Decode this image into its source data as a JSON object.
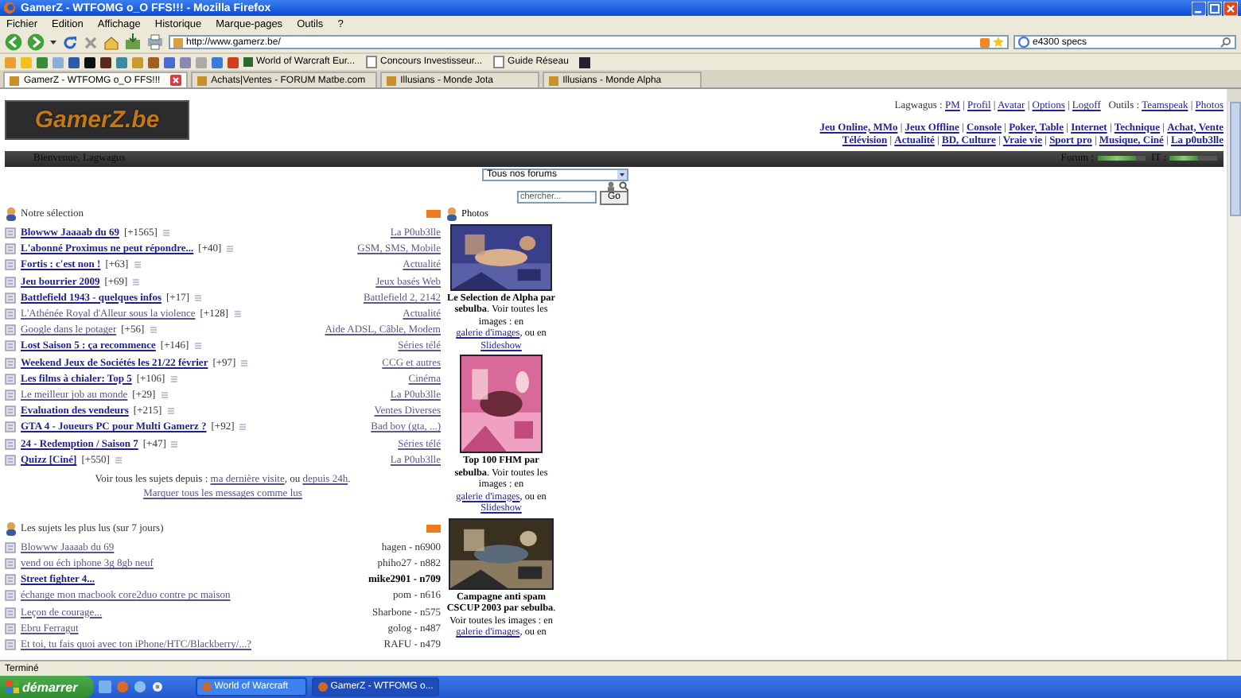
{
  "window": {
    "title": "GamerZ - WTFOMG o_O FFS!!! - Mozilla Firefox"
  },
  "menu": [
    "Fichier",
    "Edition",
    "Affichage",
    "Historique",
    "Marque-pages",
    "Outils",
    "?"
  ],
  "address": {
    "value": "http://www.gamerz.be/"
  },
  "search": {
    "value": "e4300 specs"
  },
  "bookmarks": [
    "World of Warcraft Eur...",
    "Concours Investisseur...",
    "Guide Réseau"
  ],
  "tabs": [
    {
      "label": "GamerZ - WTFOMG o_O FFS!!!",
      "selected": true
    },
    {
      "label": "Achats|Ventes - FORUM Matbe.com",
      "selected": false
    },
    {
      "label": "Illusians - Monde Jota",
      "selected": false
    },
    {
      "label": "Illusians - Monde Alpha",
      "selected": false
    }
  ],
  "site": {
    "logo": "GamerZ.be",
    "separator": "|",
    "user_label": "Lagwagus :",
    "user_links": [
      "PM",
      "Profil",
      "Avatar",
      "Options",
      "Logoff"
    ],
    "tools_label": "Outils :",
    "tools_links": [
      "Teamspeak",
      "Photos"
    ],
    "categories": [
      [
        "Jeu Online, MMo",
        "Jeux Offline",
        "Console",
        "Poker, Table",
        "Internet",
        "Technique",
        "Achat, Vente"
      ],
      [
        "Télévision",
        "Actualité",
        "BD, Culture",
        "Vraie vie",
        "Sport pro",
        "Musique, Ciné",
        "La p0ub3lle"
      ]
    ],
    "welcome": "Bienvenue, Lagwagus",
    "meters": [
      {
        "label": "Forum :",
        "level": 0.8
      },
      {
        "label": "IT :",
        "level": 0.6
      }
    ]
  },
  "forum_select": {
    "value": "Tous nos forums"
  },
  "forum_search": {
    "placeholder": "chercher...",
    "button": "Go"
  },
  "selection": {
    "title": "Notre sélection",
    "topics": [
      {
        "title": "Blowww Jaaaab du 69",
        "count": "[+1565]",
        "unread": true,
        "category": "La P0ub3lle"
      },
      {
        "title": "L'abonné Proximus ne peut répondre...",
        "count": "[+40]",
        "unread": true,
        "category": "GSM, SMS, Mobile"
      },
      {
        "title": "Fortis : c'est non !",
        "count": "[+63]",
        "unread": true,
        "category": "Actualité"
      },
      {
        "title": "Jeu bourrier 2009",
        "count": "[+69]",
        "unread": true,
        "category": "Jeux basés Web"
      },
      {
        "title": "Battlefield 1943 - quelques infos",
        "count": "[+17]",
        "unread": true,
        "category": "Battlefield 2, 2142"
      },
      {
        "title": "L'Athénée Royal d'Alleur sous la violence",
        "count": "[+128]",
        "unread": false,
        "category": "Actualité"
      },
      {
        "title": "Google dans le potager",
        "count": "[+56]",
        "unread": false,
        "category": "Aide ADSL, Câble, Modem"
      },
      {
        "title": "Lost Saison 5 : ça recommence",
        "count": "[+146]",
        "unread": true,
        "category": "Séries télé"
      },
      {
        "title": "Weekend Jeux de Sociétés les 21/22 février",
        "count": "[+97]",
        "unread": true,
        "category": "CCG et autres"
      },
      {
        "title": "Les films à chialer: Top 5",
        "count": "[+106]",
        "unread": true,
        "category": "Cinéma"
      },
      {
        "title": "Le meilleur job au monde",
        "count": "[+29]",
        "unread": false,
        "category": "La P0ub3lle"
      },
      {
        "title": "Evaluation des vendeurs",
        "count": "[+215]",
        "unread": true,
        "category": "Ventes Diverses"
      },
      {
        "title": "GTA 4 - Joueurs PC pour Multi Gamerz ?",
        "count": "[+92]",
        "unread": true,
        "category": "Bad boy (gta, ...)"
      },
      {
        "title": "24 - Redemption / Saison 7",
        "count": "[+47]",
        "unread": true,
        "category": "Séries télé"
      },
      {
        "title": "Quizz [Ciné]",
        "count": "[+550]",
        "unread": true,
        "category": "La P0ub3lle"
      }
    ],
    "footer": {
      "text": "Voir tous les sujets depuis :",
      "link1": "ma dernière visite",
      "middle": ", ou",
      "link2": "depuis 24h",
      "end": ".",
      "mark_all": "Marquer tous les messages comme lus"
    }
  },
  "most_read": {
    "title": "Les sujets les plus lus (sur 7 jours)",
    "topics": [
      {
        "title": "Blowww Jaaaab du 69",
        "author": "hagen - n6900",
        "unread": false
      },
      {
        "title": "vend ou éch iphone 3g 8gb neuf",
        "author": "phiho27 - n882",
        "unread": false
      },
      {
        "title": "Street fighter 4...",
        "author": "mike2901 - n709",
        "unread": true
      },
      {
        "title": "échange mon macbook core2duo contre pc maison",
        "author": "pom - n616",
        "unread": false
      },
      {
        "title": "Leçon de courage...",
        "author": "Sharbone - n575",
        "unread": false
      },
      {
        "title": "Ebru Ferragut",
        "author": "golog - n487",
        "unread": false
      },
      {
        "title": "Et toi, tu fais quoi avec ton iPhone/HTC/Blackberry/...?",
        "author": "RAFU - n479",
        "unread": false
      }
    ]
  },
  "photos": {
    "title": "Photos",
    "items": [
      {
        "kind": "picture",
        "title": "Le Selection de Alpha par sebulba",
        "text": ". Voir toutes les images : en",
        "gallery": "galerie d'images",
        "middle": ", ou en",
        "slideshow": "Slideshow"
      },
      {
        "kind": "picture",
        "title": "Top 100 FHM par sebulba",
        "text": ". Voir toutes les images : en",
        "gallery": "galerie d'images",
        "middle": ", ou en",
        "slideshow": "Slideshow"
      },
      {
        "kind": "picture",
        "title": "Campagne anti spam CSCUP 2003 par sebulba",
        "text": ". Voir toutes les images : en",
        "gallery": "galerie d'images",
        "middle": ", ou en"
      }
    ]
  },
  "status_bar": "Terminé",
  "taskbar": {
    "start": "démarrer",
    "windows": [
      {
        "label": "World of Warcraft",
        "selected": false
      },
      {
        "label": "GamerZ - WTFOMG o...",
        "selected": true
      }
    ]
  }
}
